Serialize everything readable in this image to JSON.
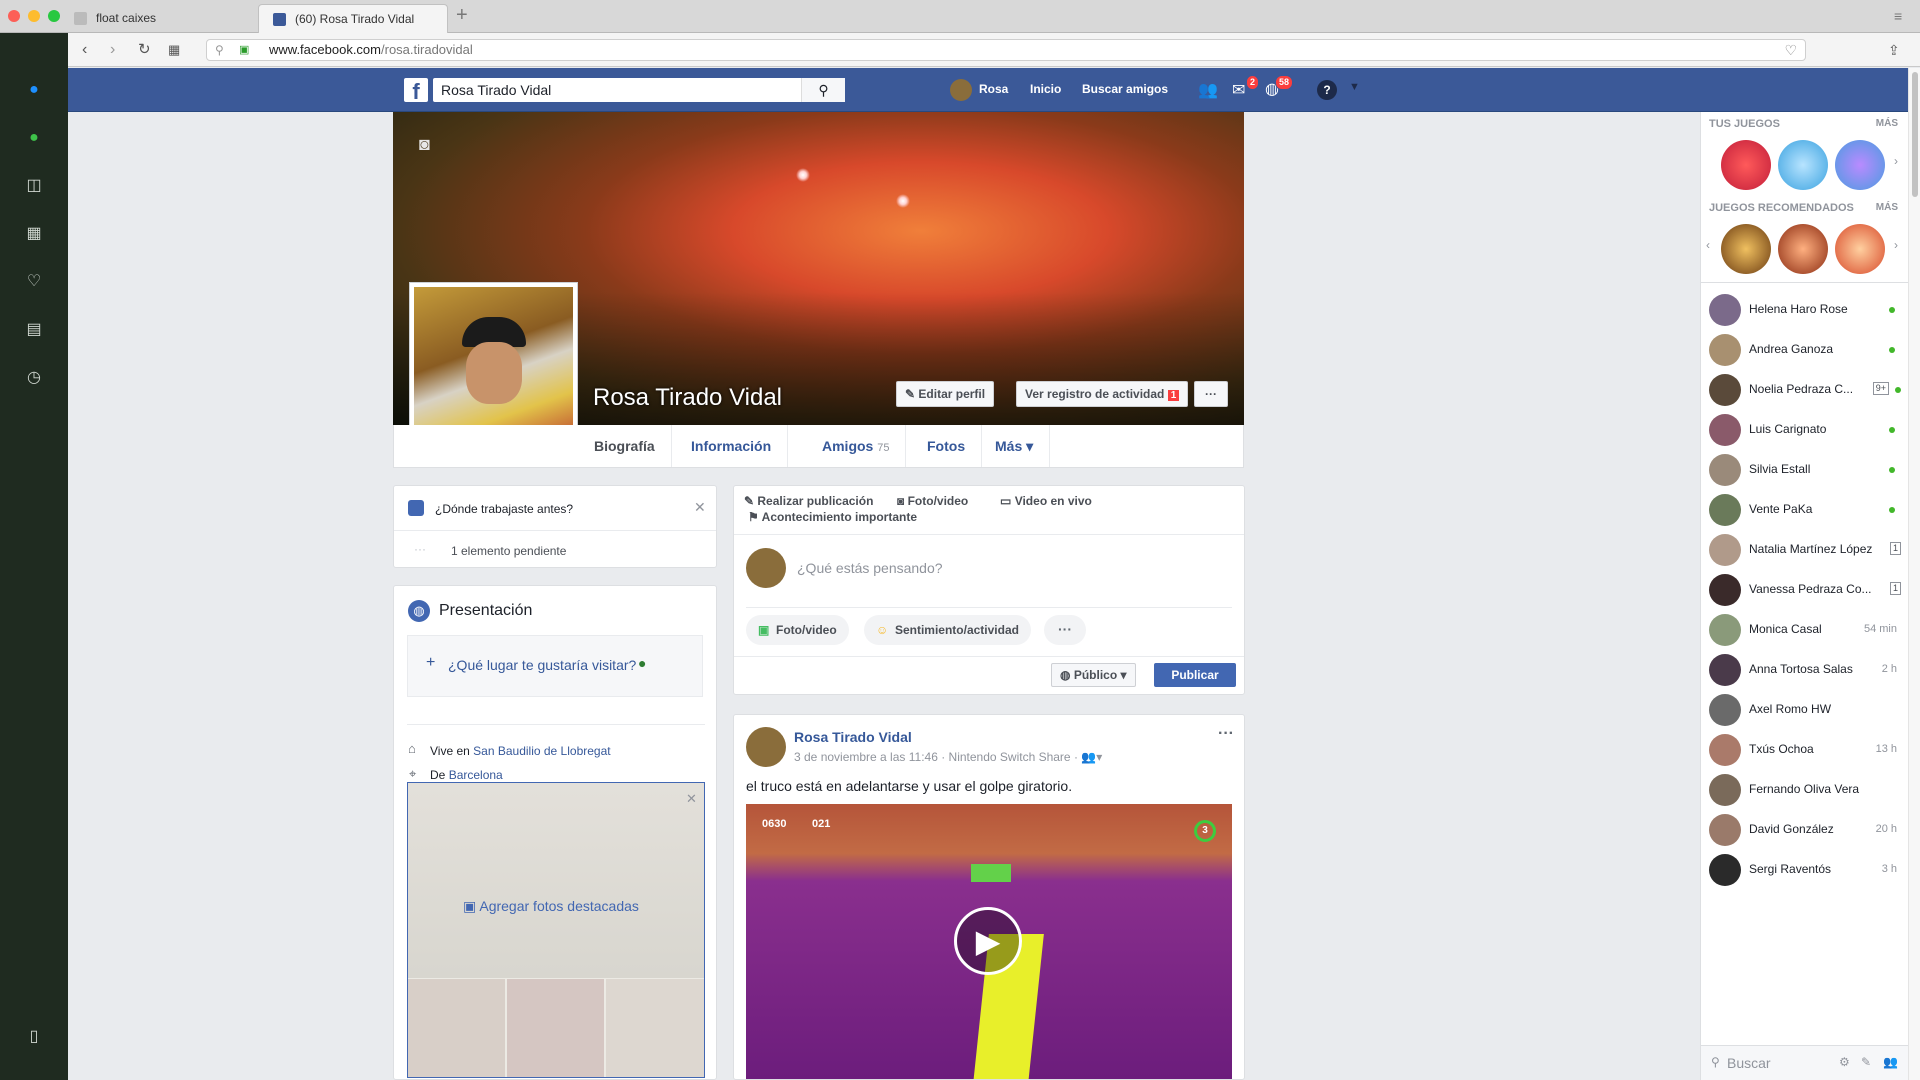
{
  "browser": {
    "tabs": [
      {
        "label": "float caixes"
      },
      {
        "label": "(60) Rosa Tirado Vidal"
      }
    ],
    "url_host": "www.facebook.com",
    "url_path": "/rosa.tiradovidal"
  },
  "fb": {
    "search_value": "Rosa Tirado Vidal",
    "nav_user": "Rosa",
    "nav_home": "Inicio",
    "nav_find_friends": "Buscar amigos",
    "messages_badge": "2",
    "notifications_badge": "58",
    "help": "?"
  },
  "profile": {
    "name": "Rosa Tirado Vidal",
    "edit_profile": "Editar perfil",
    "activity_log": "Ver registro de actividad",
    "activity_badge": "1",
    "more_dots": "···",
    "tabs": {
      "timeline": "Biografía",
      "about": "Información",
      "friends": "Amigos",
      "friends_count": "75",
      "photos": "Fotos",
      "more": "Más"
    }
  },
  "left": {
    "work_prompt": "¿Dónde trabajaste antes?",
    "pending": "1 elemento pendiente",
    "intro_title": "Presentación",
    "visit_prompt": "¿Qué lugar te gustaría visitar?",
    "lives_prefix": "Vive en",
    "lives_place": "San Baudilio de Llobregat",
    "from_prefix": "De",
    "from_place": "Barcelona",
    "featured_photos": "Agregar fotos destacadas"
  },
  "composer": {
    "make_post": "Realizar publicación",
    "photo_video": "Foto/video",
    "live_video": "Video en vivo",
    "life_event": "Acontecimiento importante",
    "placeholder": "¿Qué estás pensando?",
    "chip_photo": "Foto/video",
    "chip_feeling": "Sentimiento/actividad",
    "chip_more": "···",
    "audience": "Público",
    "publish": "Publicar"
  },
  "post": {
    "author": "Rosa Tirado Vidal",
    "meta": "3 de noviembre a las 11:46 · Nintendo Switch Share ·",
    "text": "el truco está en adelantarse y usar el golpe giratorio.",
    "hud_coins": "0630",
    "hud_moons": "021",
    "hud_life": "3",
    "options": "···"
  },
  "right": {
    "your_games": "TUS JUEGOS",
    "recommended_games": "JUEGOS RECOMENDADOS",
    "more": "MÁS",
    "search_placeholder": "Buscar",
    "friends": [
      {
        "name": "Helena Haro Rose",
        "status": "online"
      },
      {
        "name": "Andrea Ganoza",
        "status": "online"
      },
      {
        "name": "Noelia Pedraza C...",
        "status": "online",
        "box": "9+"
      },
      {
        "name": "Luis Carignato",
        "status": "online"
      },
      {
        "name": "Silvia Estall",
        "status": "online"
      },
      {
        "name": "Vente PaKa",
        "status": "online"
      },
      {
        "name": "Natalia Martínez López",
        "box": "1"
      },
      {
        "name": "Vanessa Pedraza Co...",
        "box": "1"
      },
      {
        "name": "Monica Casal",
        "time": "54 min"
      },
      {
        "name": "Anna Tortosa Salas",
        "time": "2 h"
      },
      {
        "name": "Axel Romo HW"
      },
      {
        "name": "Txús Ochoa",
        "time": "13 h"
      },
      {
        "name": "Fernando Oliva Vera"
      },
      {
        "name": "David González",
        "time": "20 h"
      },
      {
        "name": "Sergi Raventós",
        "time": "3 h"
      }
    ]
  },
  "colors": {
    "fb_blue": "#3b5998",
    "link": "#365899",
    "online": "#42b72a",
    "badge": "#fa3e3e",
    "sidebar_dark": "#1f2b20"
  }
}
